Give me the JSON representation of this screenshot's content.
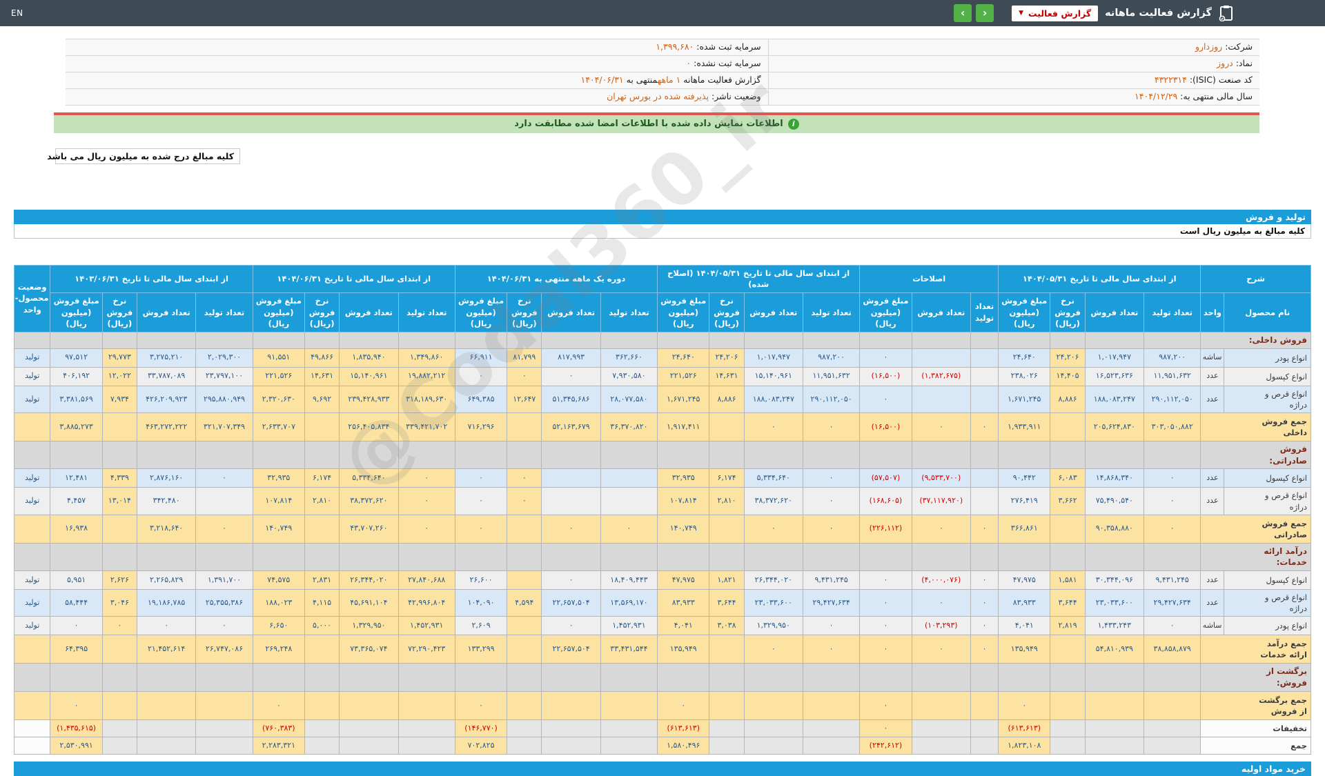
{
  "topbar": {
    "title": "گزارش فعالیت ماهانه",
    "report_button": "گزارش فعالیت",
    "lang": "EN"
  },
  "info": {
    "rows": [
      {
        "right": [
          {
            "t": "شرکت: ",
            "k": "label"
          },
          {
            "t": "روزدارو",
            "k": "value",
            "link": true
          }
        ],
        "left": [
          {
            "t": "سرمایه ثبت شده: ",
            "k": "label"
          },
          {
            "t": "۱,۳۹۹,۶۸۰",
            "k": "value"
          }
        ]
      },
      {
        "right": [
          {
            "t": "نماد: ",
            "k": "label"
          },
          {
            "t": "دروز",
            "k": "value",
            "link": true
          }
        ],
        "left": [
          {
            "t": "سرمایه ثبت نشده: ",
            "k": "label"
          },
          {
            "t": "۰",
            "k": "value"
          }
        ]
      },
      {
        "right": [
          {
            "t": "کد صنعت (ISIC): ",
            "k": "label"
          },
          {
            "t": "۴۳۲۲۳۱۴",
            "k": "value"
          }
        ],
        "left": [
          {
            "t": "گزارش فعالیت ماهانه ",
            "k": "label"
          },
          {
            "t": "۱ ماهه",
            "k": "value"
          },
          {
            "t": "منتهی به ",
            "k": "label"
          },
          {
            "t": "۱۴۰۴/۰۶/۳۱",
            "k": "value"
          }
        ]
      },
      {
        "right": [
          {
            "t": "سال مالی منتهی به: ",
            "k": "label"
          },
          {
            "t": "۱۴۰۴/۱۲/۲۹",
            "k": "value"
          }
        ],
        "left": [
          {
            "t": "وضعیت ناشر: ",
            "k": "label"
          },
          {
            "t": "پذیرفته شده در بورس تهران",
            "k": "value"
          }
        ]
      }
    ]
  },
  "notice": {
    "text": "اطلاعات نمایش داده شده با اطلاعات امضا شده مطابقت دارد"
  },
  "unit_note": "کلیه مبالغ درج شده به میلیون ریال می باشد",
  "section": {
    "title": "تولید و فروش",
    "subtitle": "کلیه مبالغ به میلیون ریال است"
  },
  "next_section": "خرید مواد اولیه",
  "watermark": "@Codal360_ir",
  "table": {
    "col_headers": {
      "desc": "شرح",
      "product": "نام محصول",
      "unit": "واحد",
      "qty_prod": "تعداد تولید",
      "qty_sale": "تعداد فروش",
      "rate": "نرخ فروش\n(ریال)",
      "amount": "مبلغ فروش\n(میلیون ریال)",
      "status": "وضعیت\nمحصول-واحد"
    },
    "groups": [
      {
        "label": "از ابتدای سال مالی تا تاریخ ۱۴۰۴/۰۵/۳۱",
        "kind": "g4"
      },
      {
        "label": "اصلاحات",
        "kind": "g3"
      },
      {
        "label": "از ابتدای سال مالی تا تاریخ ۱۴۰۴/۰۵/۳۱ (اصلاح شده)",
        "kind": "g4"
      },
      {
        "label": "دوره یک ماهه منتهی به ۱۴۰۴/۰۶/۳۱",
        "kind": "g4"
      },
      {
        "label": "از ابتدای سال مالی تا تاریخ ۱۴۰۴/۰۶/۳۱",
        "kind": "g4"
      },
      {
        "label": "از ابتدای سال مالی تا تاریخ ۱۴۰۳/۰۶/۳۱",
        "kind": "g4"
      }
    ],
    "rows": [
      {
        "type": "category",
        "name": "فروش داخلی:",
        "unit": "",
        "status": "",
        "shade": "",
        "cells": [
          "",
          "",
          "",
          "",
          "",
          "",
          "",
          "",
          "",
          "",
          "",
          "",
          "",
          "",
          "",
          "",
          "",
          "",
          "",
          "",
          "",
          "",
          ""
        ]
      },
      {
        "type": "product",
        "name": "انواع پودر",
        "unit": "ساشه",
        "status": "تولید",
        "shade": "b",
        "cells": [
          "۹۸۷,۲۰۰",
          "۱,۰۱۷,۹۴۷",
          "۲۴,۲۰۶",
          "۲۴,۶۴۰",
          "",
          "",
          "۰",
          "۹۸۷,۲۰۰",
          "۱,۰۱۷,۹۴۷",
          "۲۴,۲۰۶",
          "۲۴,۶۴۰",
          "۳۶۲,۶۶۰",
          "۸۱۷,۹۹۳",
          "۸۱,۷۹۹",
          "۶۶,۹۱۱",
          "۱,۳۴۹,۸۶۰",
          "۱,۸۳۵,۹۴۰",
          "۴۹,۸۶۶",
          "۹۱,۵۵۱",
          "۲,۰۲۹,۳۰۰",
          "۳,۲۷۵,۲۱۰",
          "۲۹,۷۷۳",
          "۹۷,۵۱۲"
        ]
      },
      {
        "type": "product",
        "name": "انواع کپسول",
        "unit": "عدد",
        "status": "تولید",
        "shade": "g",
        "cells": [
          "۱۱,۹۵۱,۶۳۲",
          "۱۶,۵۲۳,۶۳۶",
          "۱۴,۴۰۵",
          "۲۳۸,۰۲۶",
          "",
          "(۱,۳۸۲,۶۷۵)",
          "(۱۶,۵۰۰)",
          "۱۱,۹۵۱,۶۳۲",
          "۱۵,۱۴۰,۹۶۱",
          "۱۴,۶۳۱",
          "۲۲۱,۵۲۶",
          "۷,۹۳۰,۵۸۰",
          "۰",
          "۰",
          "۰",
          "۱۹,۸۸۲,۲۱۲",
          "۱۵,۱۴۰,۹۶۱",
          "۱۴,۶۳۱",
          "۲۲۱,۵۲۶",
          "۲۳,۷۹۷,۱۰۰",
          "۳۳,۷۸۷,۰۸۹",
          "۱۲,۰۲۲",
          "۴۰۶,۱۹۲"
        ]
      },
      {
        "type": "product",
        "name": "انواع قرص و\nدراژه",
        "unit": "عدد",
        "status": "تولید",
        "shade": "b",
        "cells": [
          "۲۹۰,۱۱۲,۰۵۰",
          "۱۸۸,۰۸۳,۲۴۷",
          "۸,۸۸۶",
          "۱,۶۷۱,۲۴۵",
          "",
          "",
          "۰",
          "۲۹۰,۱۱۲,۰۵۰",
          "۱۸۸,۰۸۳,۲۴۷",
          "۸,۸۸۶",
          "۱,۶۷۱,۲۴۵",
          "۲۸,۰۷۷,۵۸۰",
          "۵۱,۳۴۵,۶۸۶",
          "۱۲,۶۴۷",
          "۶۴۹,۳۸۵",
          "۳۱۸,۱۸۹,۶۳۰",
          "۲۳۹,۴۲۸,۹۳۳",
          "۹,۶۹۲",
          "۲,۳۲۰,۶۳۰",
          "۲۹۵,۸۸۰,۹۴۹",
          "۴۲۶,۲۰۹,۹۲۳",
          "۷,۹۳۴",
          "۳,۳۸۱,۵۶۹"
        ]
      },
      {
        "type": "total",
        "name": "جمع فروش\nداخلی",
        "unit": "",
        "status": "",
        "shade": "",
        "cells": [
          "۳۰۳,۰۵۰,۸۸۲",
          "۲۰۵,۶۲۴,۸۳۰",
          "",
          "۱,۹۳۳,۹۱۱",
          "۰",
          "۰",
          "(۱۶,۵۰۰)",
          "۰",
          "۰",
          "",
          "۱,۹۱۷,۴۱۱",
          "۳۶,۳۷۰,۸۲۰",
          "۵۲,۱۶۳,۶۷۹",
          "",
          "۷۱۶,۲۹۶",
          "۳۳۹,۴۲۱,۷۰۲",
          "۲۵۶,۴۰۵,۸۳۴",
          "",
          "۲,۶۳۳,۷۰۷",
          "۳۲۱,۷۰۷,۳۴۹",
          "۴۶۳,۲۷۲,۲۲۲",
          "",
          "۳,۸۸۵,۲۷۳"
        ]
      },
      {
        "type": "category",
        "name": "فروش\nصادراتی:",
        "unit": "",
        "status": "",
        "shade": "",
        "cells": [
          "",
          "",
          "",
          "",
          "",
          "",
          "",
          "",
          "",
          "",
          "",
          "",
          "",
          "",
          "",
          "",
          "",
          "",
          "",
          "",
          "",
          "",
          ""
        ]
      },
      {
        "type": "product",
        "name": "انواع کپسول",
        "unit": "عدد",
        "status": "تولید",
        "shade": "b",
        "cells": [
          "۰",
          "۱۴,۸۶۸,۳۴۰",
          "۶,۰۸۳",
          "۹۰,۴۴۲",
          "",
          "(۹,۵۳۳,۷۰۰)",
          "(۵۷,۵۰۷)",
          "۰",
          "۵,۳۳۴,۶۴۰",
          "۶,۱۷۴",
          "۳۲,۹۳۵",
          "",
          "",
          "۰",
          "۰",
          "۰",
          "۵,۳۳۴,۶۴۰",
          "۶,۱۷۴",
          "۳۲,۹۳۵",
          "۰",
          "۲,۸۷۶,۱۶۰",
          "۴,۳۳۹",
          "۱۲,۴۸۱"
        ]
      },
      {
        "type": "product",
        "name": "انواع قرص و\nدراژه",
        "unit": "عدد",
        "status": "تولید",
        "shade": "g",
        "cells": [
          "۰",
          "۷۵,۴۹۰,۵۴۰",
          "۳,۶۶۲",
          "۲۷۶,۴۱۹",
          "",
          "(۳۷,۱۱۷,۹۲۰)",
          "(۱۶۸,۶۰۵)",
          "۰",
          "۳۸,۳۷۲,۶۲۰",
          "۲,۸۱۰",
          "۱۰۷,۸۱۴",
          "",
          "",
          "۰",
          "۰",
          "۰",
          "۳۸,۳۷۲,۶۲۰",
          "۲,۸۱۰",
          "۱۰۷,۸۱۴",
          "",
          "۳۴۲,۴۸۰",
          "۱۳,۰۱۴",
          "۴,۴۵۷"
        ]
      },
      {
        "type": "total",
        "name": "جمع فروش\nصادراتی",
        "unit": "",
        "status": "",
        "shade": "",
        "cells": [
          "۰",
          "۹۰,۳۵۸,۸۸۰",
          "",
          "۳۶۶,۸۶۱",
          "۰",
          "۰",
          "(۲۲۶,۱۱۲)",
          "۰",
          "۰",
          "",
          "۱۴۰,۷۴۹",
          "۰",
          "۰",
          "",
          "۰",
          "۰",
          "۴۳,۷۰۷,۲۶۰",
          "",
          "۱۴۰,۷۴۹",
          "۰",
          "۳,۲۱۸,۶۴۰",
          "",
          "۱۶,۹۳۸"
        ]
      },
      {
        "type": "category",
        "name": "درآمد ارائه\nخدمات:",
        "unit": "",
        "status": "",
        "shade": "",
        "cells": [
          "",
          "",
          "",
          "",
          "",
          "",
          "",
          "",
          "",
          "",
          "",
          "",
          "",
          "",
          "",
          "",
          "",
          "",
          "",
          "",
          "",
          "",
          ""
        ]
      },
      {
        "type": "product",
        "name": "انواع کپسول",
        "unit": "عدد",
        "status": "تولید",
        "shade": "g",
        "cells": [
          "۹,۴۳۱,۲۴۵",
          "۳۰,۳۴۴,۰۹۶",
          "۱,۵۸۱",
          "۴۷,۹۷۵",
          "۰",
          "(۴,۰۰۰,۰۷۶)",
          "۰",
          "۹,۴۳۱,۲۴۵",
          "۲۶,۳۴۴,۰۲۰",
          "۱,۸۲۱",
          "۴۷,۹۷۵",
          "۱۸,۴۰۹,۴۴۳",
          "۰",
          "",
          "۲۶,۶۰۰",
          "۲۷,۸۴۰,۶۸۸",
          "۲۶,۳۴۴,۰۲۰",
          "۲,۸۳۱",
          "۷۴,۵۷۵",
          "۱,۳۹۱,۷۰۰",
          "۲,۲۶۵,۸۲۹",
          "۲,۶۲۶",
          "۵,۹۵۱"
        ]
      },
      {
        "type": "product",
        "name": "انواع قرص و\nدراژه",
        "unit": "عدد",
        "status": "تولید",
        "shade": "b",
        "cells": [
          "۲۹,۴۲۷,۶۳۴",
          "۲۳,۰۳۳,۶۰۰",
          "۳,۶۴۴",
          "۸۳,۹۳۳",
          "۰",
          "۰",
          "۰",
          "۲۹,۴۲۷,۶۳۴",
          "۲۳,۰۳۳,۶۰۰",
          "۳,۶۴۴",
          "۸۳,۹۳۳",
          "۱۳,۵۶۹,۱۷۰",
          "۲۲,۶۵۷,۵۰۴",
          "۴,۵۹۴",
          "۱۰۴,۰۹۰",
          "۴۲,۹۹۶,۸۰۴",
          "۴۵,۶۹۱,۱۰۴",
          "۴,۱۱۵",
          "۱۸۸,۰۲۳",
          "۲۵,۳۵۵,۳۸۶",
          "۱۹,۱۸۶,۷۸۵",
          "۳,۰۴۶",
          "۵۸,۴۴۴"
        ]
      },
      {
        "type": "product",
        "name": "انواع پودر",
        "unit": "ساشه",
        "status": "تولید",
        "shade": "g",
        "cells": [
          "۰",
          "۱,۴۳۳,۲۴۳",
          "۲,۸۱۹",
          "۴,۰۴۱",
          "۰",
          "(۱۰۳,۲۹۳)",
          "۰",
          "۰",
          "۱,۳۲۹,۹۵۰",
          "۳,۰۳۸",
          "۴,۰۴۱",
          "۱,۴۵۲,۹۳۱",
          "۰",
          "",
          "۲,۶۰۹",
          "۱,۴۵۲,۹۳۱",
          "۱,۳۲۹,۹۵۰",
          "۵,۰۰۰",
          "۶,۶۵۰",
          "۰",
          "۰",
          "۰",
          "۰"
        ]
      },
      {
        "type": "total",
        "name": "جمع درآمد\nارائه خدمات",
        "unit": "",
        "status": "",
        "shade": "",
        "cells": [
          "۳۸,۸۵۸,۸۷۹",
          "۵۴,۸۱۰,۹۳۹",
          "",
          "۱۳۵,۹۴۹",
          "۰",
          "۰",
          "۰",
          "۰",
          "۰",
          "",
          "۱۳۵,۹۴۹",
          "۳۳,۴۳۱,۵۴۴",
          "۲۲,۶۵۷,۵۰۴",
          "",
          "۱۳۳,۲۹۹",
          "۷۲,۲۹۰,۴۲۳",
          "۷۳,۳۶۵,۰۷۴",
          "",
          "۲۶۹,۲۴۸",
          "۲۶,۷۴۷,۰۸۶",
          "۲۱,۴۵۲,۶۱۴",
          "",
          "۶۴,۳۹۵"
        ]
      },
      {
        "type": "category",
        "name": "برگشت از\nفروش:",
        "unit": "",
        "status": "",
        "shade": "",
        "cells": [
          "",
          "",
          "",
          "",
          "",
          "",
          "",
          "",
          "",
          "",
          "",
          "",
          "",
          "",
          "",
          "",
          "",
          "",
          "",
          "",
          "",
          "",
          ""
        ]
      },
      {
        "type": "total",
        "name": "جمع برگشت\nاز فروش",
        "unit": "",
        "status": "",
        "shade": "",
        "cells": [
          "",
          "",
          "",
          "۰",
          "",
          "",
          "۰",
          "",
          "",
          "",
          "۰",
          "",
          "",
          "",
          "۰",
          "",
          "",
          "",
          "۰",
          "",
          "",
          "",
          "۰"
        ]
      },
      {
        "type": "grand",
        "name": "تخفیفات",
        "unit": "",
        "status": "",
        "shade": "",
        "cells": [
          "",
          "",
          "",
          "(۶۱۳,۶۱۳)",
          "",
          "",
          "۰",
          "",
          "",
          "",
          "(۶۱۳,۶۱۳)",
          "",
          "",
          "",
          "(۱۴۶,۷۷۰)",
          "",
          "",
          "",
          "(۷۶۰,۳۸۳)",
          "",
          "",
          "",
          "(۱,۴۳۵,۶۱۵)"
        ]
      },
      {
        "type": "grand",
        "name": "جمع",
        "unit": "",
        "status": "",
        "shade": "",
        "cells": [
          "",
          "",
          "",
          "۱,۸۲۳,۱۰۸",
          "",
          "",
          "(۲۴۲,۶۱۲)",
          "",
          "",
          "",
          "۱,۵۸۰,۴۹۶",
          "",
          "",
          "",
          "۷۰۲,۸۲۵",
          "",
          "",
          "",
          "۲,۲۸۳,۳۲۱",
          "",
          "",
          "",
          "۲,۵۳۰,۹۹۱"
        ]
      }
    ]
  }
}
